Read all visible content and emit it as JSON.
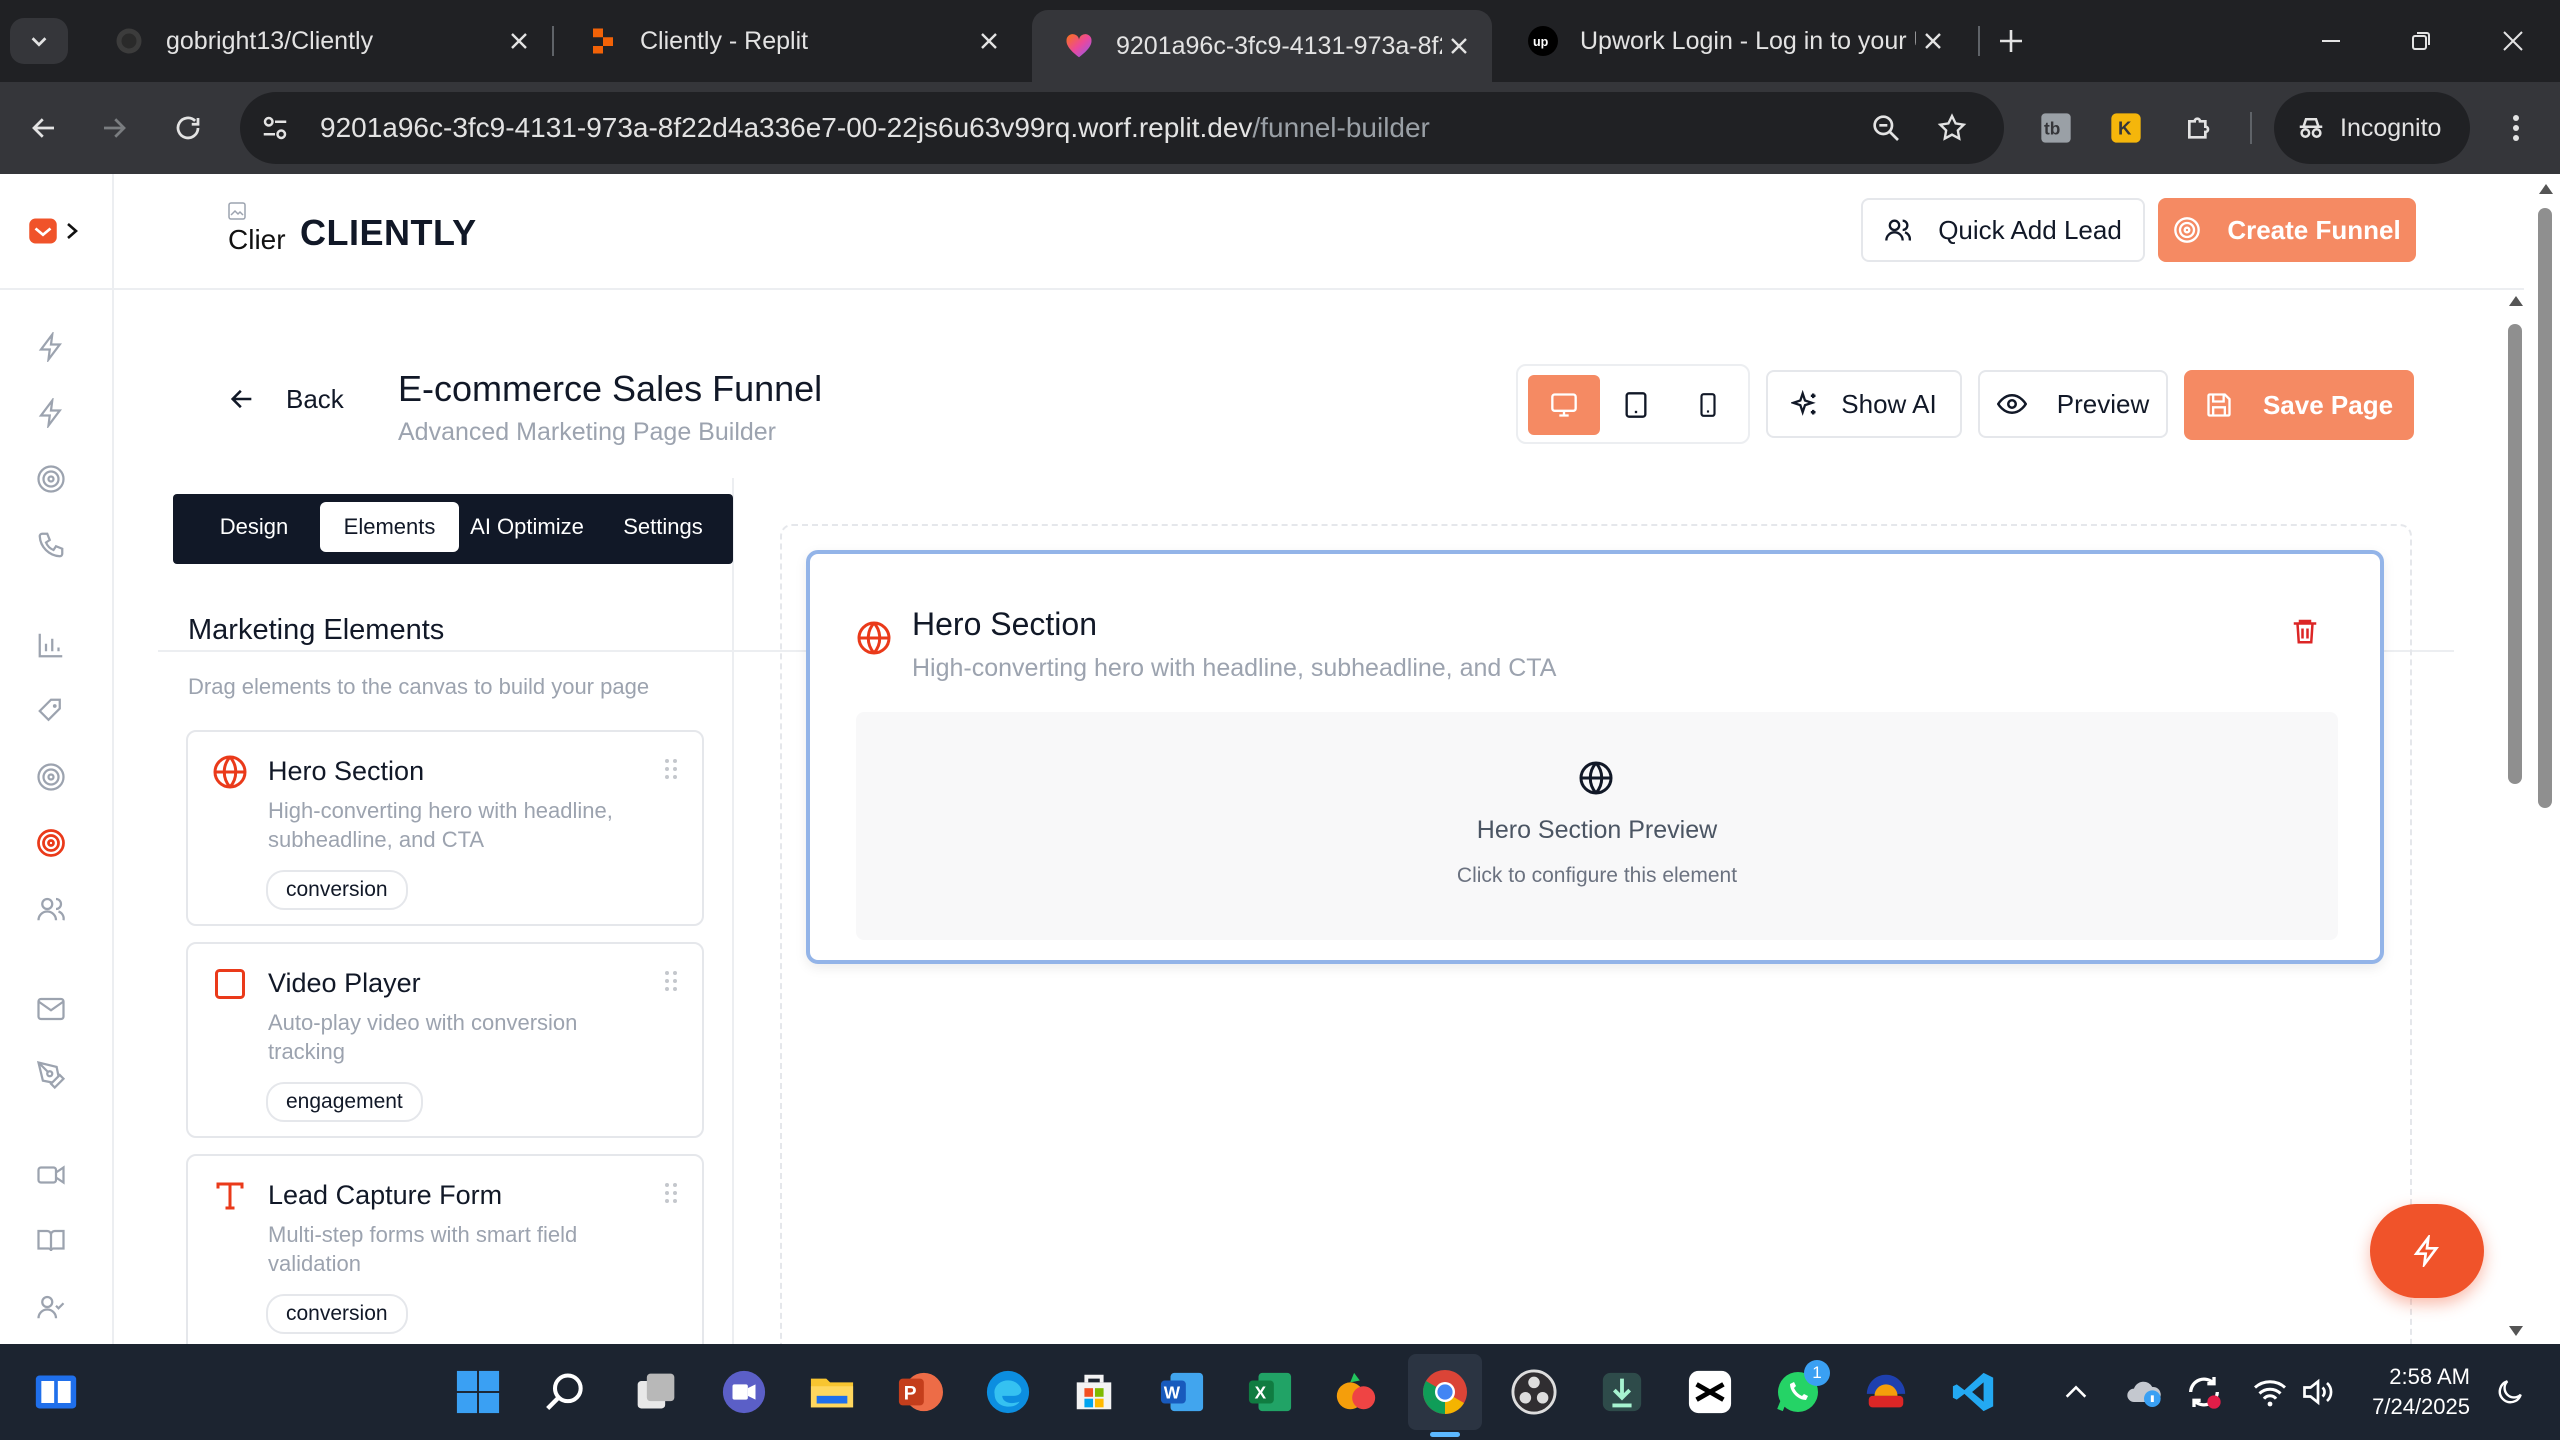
{
  "browser": {
    "tabs": [
      {
        "title": "gobright13/Cliently",
        "favicon": "github-icon",
        "active": false
      },
      {
        "title": "Cliently - Replit",
        "favicon": "replit-icon",
        "active": false
      },
      {
        "title": "9201a96c-3fc9-4131-973a-8f22",
        "favicon": "replit-heart-icon",
        "active": true
      },
      {
        "title": "Upwork Login - Log in to your U",
        "favicon": "upwork-icon",
        "active": false
      }
    ],
    "url_host": "9201a96c-3fc9-4131-973a-8f22d4a336e7-00-22js6u63v99rq.worf.replit.dev",
    "url_path": "/funnel-builder",
    "incognito_label": "Incognito"
  },
  "app": {
    "brand": "CLIENTLY",
    "logo_alt": "Clier",
    "quick_add_label": "Quick Add Lead",
    "create_funnel_label": "Create Funnel",
    "sidebar_icons": [
      "zap-icon",
      "zap-icon",
      "target-icon",
      "phone-icon",
      "bar-chart-icon",
      "tag-icon",
      "target-icon",
      "target-active-icon",
      "users-icon",
      "mail-icon",
      "pen-tool-icon",
      "video-icon",
      "book-open-icon",
      "user-check-icon"
    ]
  },
  "builder": {
    "back_label": "Back",
    "title": "E-commerce Sales Funnel",
    "subtitle": "Advanced Marketing Page Builder",
    "show_ai_label": "Show AI",
    "preview_label": "Preview",
    "save_label": "Save Page",
    "tabs": [
      "Design",
      "Elements",
      "AI Optimize",
      "Settings"
    ],
    "active_tab": "Elements",
    "panel_title": "Marketing Elements",
    "panel_hint": "Drag elements to the canvas to build your page",
    "elements": [
      {
        "title": "Hero Section",
        "desc": "High-converting hero with headline, subheadline, and CTA",
        "badge": "conversion",
        "icon": "globe-icon"
      },
      {
        "title": "Video Player",
        "desc": "Auto-play video with conversion tracking",
        "badge": "engagement",
        "icon": "square-icon"
      },
      {
        "title": "Lead Capture Form",
        "desc": "Multi-step forms with smart field validation",
        "badge": "conversion",
        "icon": "type-icon"
      }
    ],
    "canvas": {
      "section_title": "Hero Section",
      "section_desc": "High-converting hero with headline, subheadline, and CTA",
      "preview_title": "Hero Section Preview",
      "preview_hint": "Click to configure this element"
    }
  },
  "taskbar": {
    "time": "2:58 AM",
    "date": "7/24/2025",
    "whatsapp_badge": "1"
  },
  "colors": {
    "accent": "#f58a63",
    "accent_dark": "#ea580c",
    "danger": "#dc2626",
    "canvas_border": "#93b4e8"
  }
}
